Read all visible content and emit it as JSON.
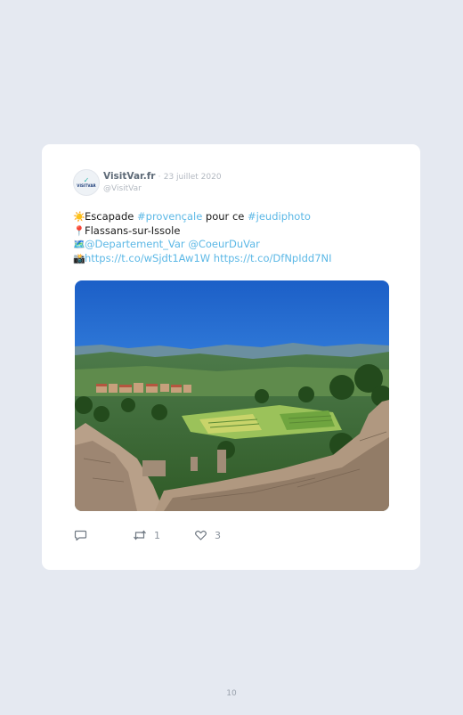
{
  "tweet": {
    "author_name": "VisitVar.fr",
    "separator": "·",
    "date": "23 juillet 2020",
    "handle": "@VisitVar",
    "avatar_text": "VISITVAR",
    "lines": [
      {
        "icon": "sun-icon",
        "emoji": "☀️",
        "parts": [
          {
            "text": "Escapade ",
            "link": false
          },
          {
            "text": "#provençale",
            "link": true
          },
          {
            "text": " pour ce ",
            "link": false
          },
          {
            "text": "#jeudiphoto",
            "link": true
          }
        ]
      },
      {
        "icon": "pin-icon",
        "emoji": "📍",
        "parts": [
          {
            "text": "Flassans-sur-Issole",
            "link": false
          }
        ]
      },
      {
        "icon": "map-icon",
        "emoji": "🗺️",
        "parts": [
          {
            "text": "@Departement_Var",
            "link": true
          },
          {
            "text": " ",
            "link": false
          },
          {
            "text": "@CoeurDuVar",
            "link": true
          }
        ]
      },
      {
        "icon": "camera-icon",
        "emoji": "📸",
        "parts": [
          {
            "text": "https://t.co/wSjdt1Aw1W",
            "link": true
          },
          {
            "text": " ",
            "link": false
          },
          {
            "text": "https://t.co/DfNpIdd7NI",
            "link": true
          }
        ]
      }
    ],
    "actions": {
      "reply_count": "",
      "retweet_count": "1",
      "like_count": "3"
    }
  },
  "footer": {
    "page_number": "10"
  },
  "colors": {
    "background": "#e5e9f1",
    "card": "#ffffff",
    "link": "#5cb8e6",
    "muted": "#b3b9c1",
    "icon": "#8a929c"
  }
}
